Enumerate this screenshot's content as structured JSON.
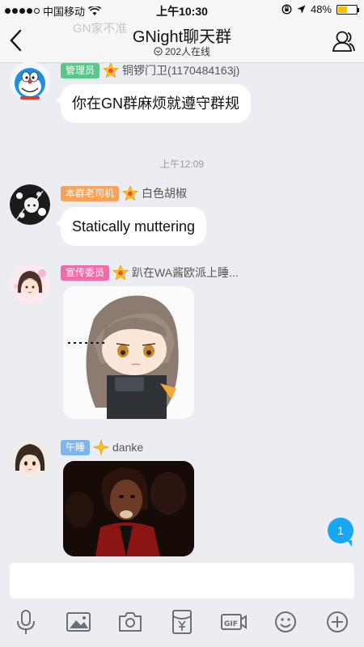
{
  "status": {
    "carrier": "中国移动",
    "time": "上午10:30",
    "battery": "48%",
    "battery_level": 0.48
  },
  "nav": {
    "title": "GNight聊天群",
    "online": "202人在线",
    "ghost_text": "GN家不准"
  },
  "messages": [
    {
      "badge": "管理员",
      "badge_color": "#5cc58b",
      "name": "铜锣门卫(1170484163j)",
      "text": "你在GN群麻烦就遵守群规"
    },
    {
      "badge": "本群老司机",
      "badge_color": "#f7a25a",
      "name": "白色胡椒",
      "text": "Statically muttering"
    },
    {
      "badge": "宣传委员",
      "badge_color": "#ef6cab",
      "name": "趴在WA酱欧派上睡..."
    },
    {
      "badge": "午睡",
      "badge_color": "#7eb6ec",
      "name": "danke"
    }
  ],
  "timestamp": "上午12:09",
  "unread_count": "1",
  "input": {
    "placeholder": ""
  }
}
